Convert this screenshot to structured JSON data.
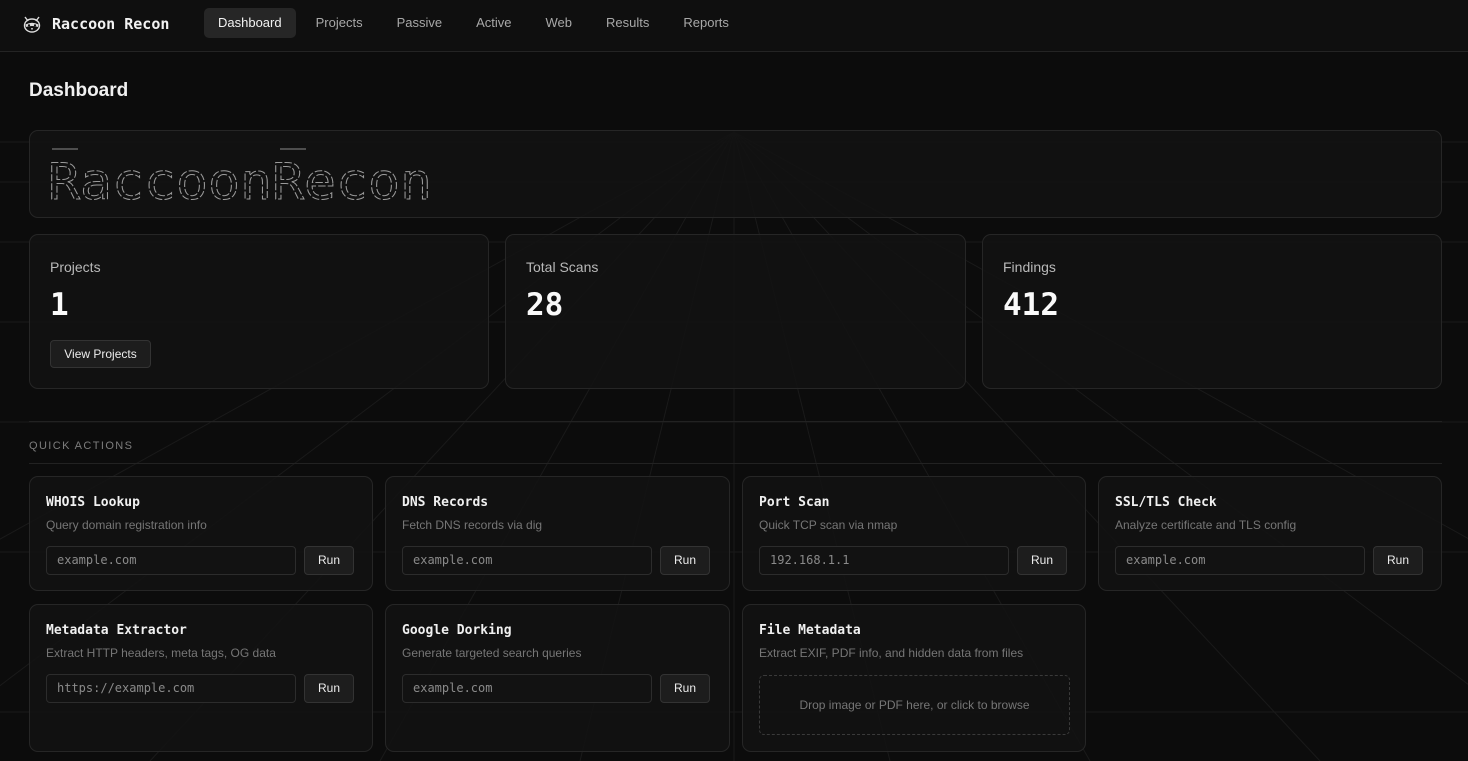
{
  "app": {
    "name": "Raccoon Recon",
    "logo_icon": "raccoon-icon"
  },
  "nav": [
    {
      "label": "Dashboard",
      "active": true
    },
    {
      "label": "Projects"
    },
    {
      "label": "Passive"
    },
    {
      "label": "Active"
    },
    {
      "label": "Web"
    },
    {
      "label": "Results"
    },
    {
      "label": "Reports"
    }
  ],
  "page": {
    "title": "Dashboard"
  },
  "banner": {
    "ascii_art_text": "RaccoonRecon"
  },
  "stats": [
    {
      "label": "Projects",
      "value": "1",
      "button": "View Projects"
    },
    {
      "label": "Total Scans",
      "value": "28"
    },
    {
      "label": "Findings",
      "value": "412"
    }
  ],
  "quick_actions": {
    "label": "QUICK ACTIONS",
    "run_label": "Run",
    "items": [
      {
        "title": "WHOIS Lookup",
        "desc": "Query domain registration info",
        "placeholder": "example.com"
      },
      {
        "title": "DNS Records",
        "desc": "Fetch DNS records via dig",
        "placeholder": "example.com"
      },
      {
        "title": "Port Scan",
        "desc": "Quick TCP scan via nmap",
        "placeholder": "192.168.1.1"
      },
      {
        "title": "SSL/TLS Check",
        "desc": "Analyze certificate and TLS config",
        "placeholder": "example.com"
      },
      {
        "title": "Metadata Extractor",
        "desc": "Extract HTTP headers, meta tags, OG data",
        "placeholder": "https://example.com"
      },
      {
        "title": "Google Dorking",
        "desc": "Generate targeted search queries",
        "placeholder": "example.com"
      },
      {
        "title": "File Metadata",
        "desc": "Extract EXIF, PDF info, and hidden data from files",
        "dropzone": "Drop image or PDF here, or click to browse"
      }
    ]
  },
  "colors": {
    "background": "#0c0c0c",
    "card": "#121212",
    "border": "#262626",
    "text": "#f0f0f0",
    "muted": "#767676"
  }
}
